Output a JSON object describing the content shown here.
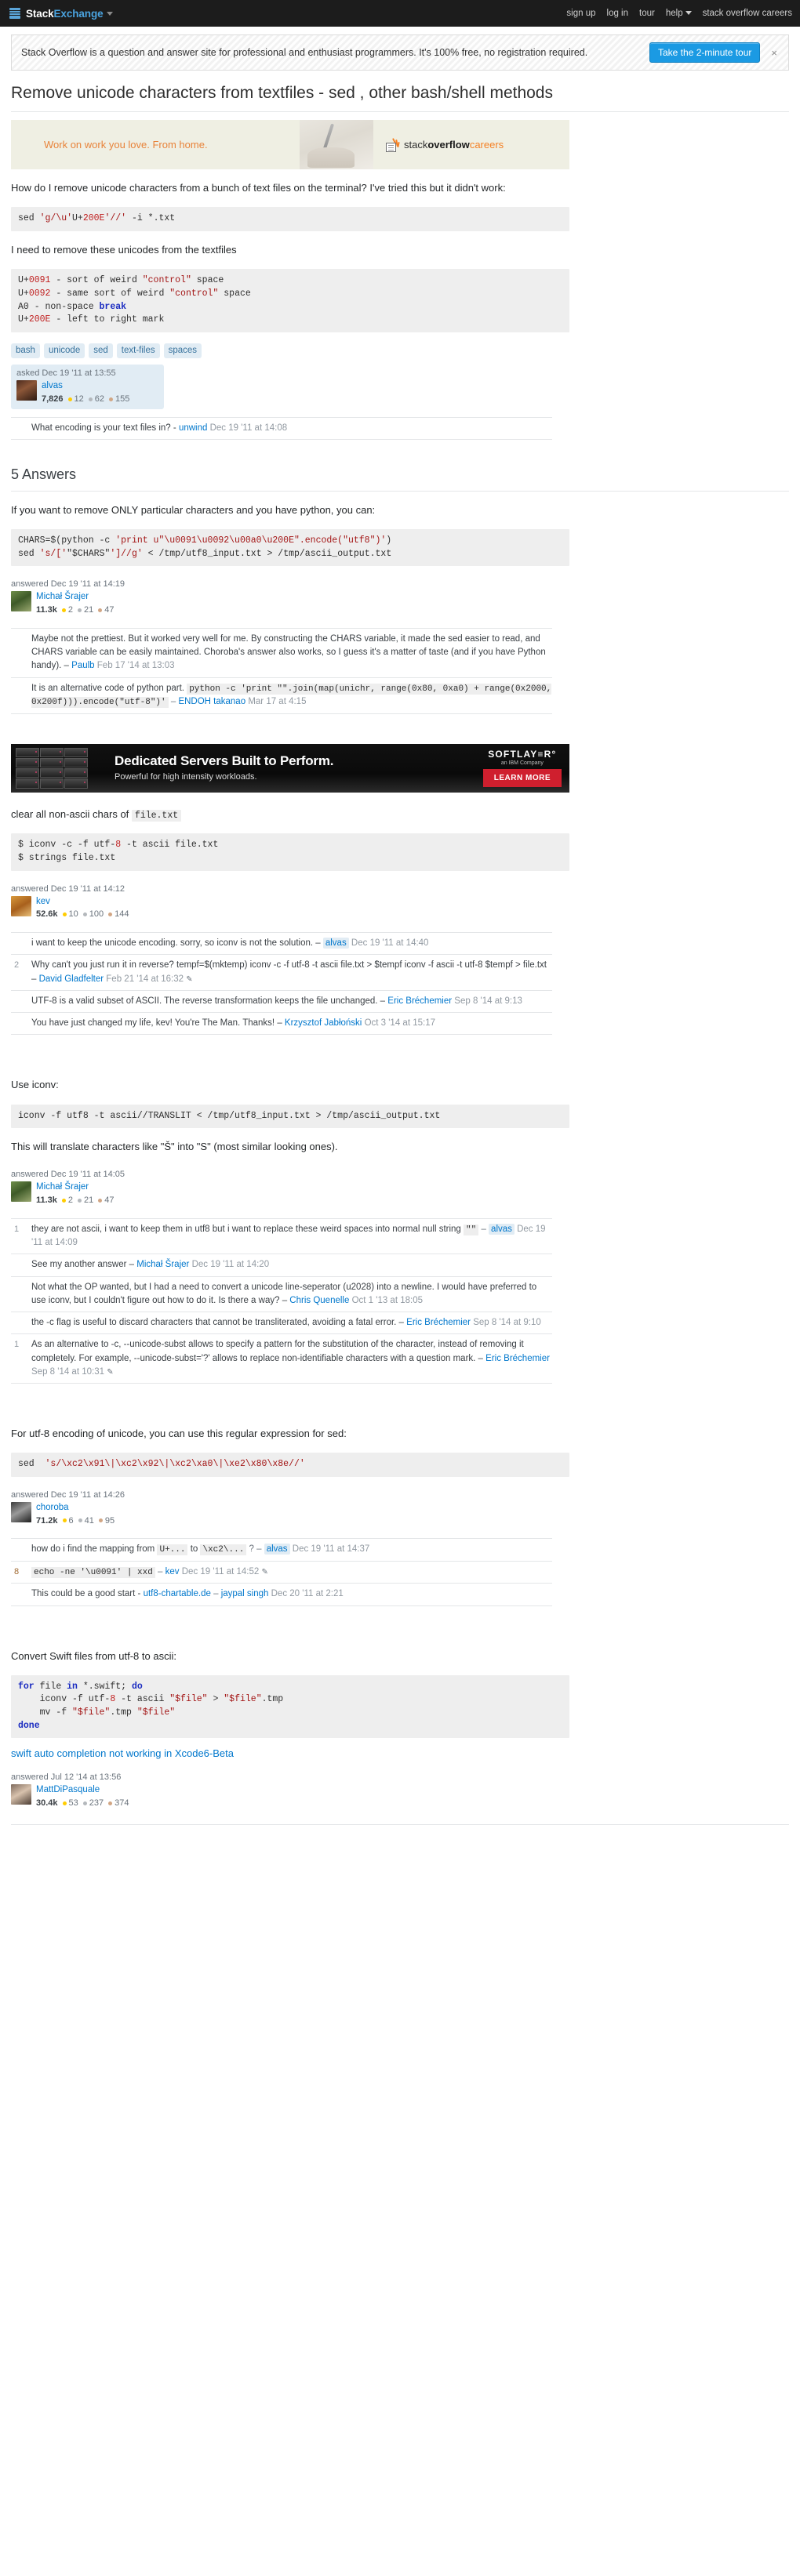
{
  "topbar": {
    "logo_icon": "stack-exchange-logo-icon",
    "brand_prefix": "Stack",
    "brand_suffix": "Exchange",
    "nav": [
      {
        "label": "sign up"
      },
      {
        "label": "log in"
      },
      {
        "label": "tour"
      },
      {
        "label": "help"
      },
      {
        "label": "stack overflow careers"
      }
    ]
  },
  "notice": {
    "text": "Stack Overflow is a question and answer site for professional and enthusiast programmers. It's 100% free, no registration required.",
    "tour_button": "Take the 2-minute tour",
    "close": "×"
  },
  "question": {
    "title": "Remove unicode characters from textfiles - sed , other bash/shell methods",
    "body_p1": "How do I remove unicode characters from a bunch of text files on the terminal? I've tried this but it didn't work:",
    "code1": "sed 'g/\\u'U+200E'//' -i *.txt",
    "body_p2": "I need to remove these unicodes from the textfiles",
    "code2_lines": [
      "U+0091 - sort of weird \"control\" space",
      "U+0092 - same sort of weird \"control\" space",
      "A0 - non-space break",
      "U+200E - left to right mark"
    ],
    "tags": [
      "bash",
      "unicode",
      "sed",
      "text-files",
      "spaces"
    ],
    "asked": "asked Dec 19 '11 at 13:55",
    "author": {
      "name": "alvas",
      "rep": "7,826",
      "gold": "12",
      "silver": "62",
      "bronze": "155",
      "avatar": "alvas"
    },
    "comments": [
      {
        "score": "",
        "text": "What encoding is your text files in? -",
        "user": "unwind",
        "owner": false,
        "date": "Dec 19 '11 at 14:08"
      }
    ]
  },
  "careers_ad": {
    "tagline": "Work on work you love. From home.",
    "logo_part1": "stack",
    "logo_part2": "overflow",
    "logo_part3": "careers"
  },
  "softlayer_ad": {
    "headline": "Dedicated Servers Built to Perform.",
    "subhead": "Powerful for high intensity workloads.",
    "logo": "SOFTLAY≡R°",
    "logo_sub": "an IBM Company",
    "cta": "LEARN MORE"
  },
  "answers_header": "5 Answers",
  "answers": [
    {
      "id": "answer-michal-python",
      "intro": "If you want to remove ONLY particular characters and you have python, you can:",
      "code_lines": [
        "CHARS=$(python -c 'print u\"\\u0091\\u0092\\u00a0\\u200E\".encode(\"utf8\")')",
        "sed 's/['\"$CHARS\"']//g' < /tmp/utf8_input.txt > /tmp/ascii_output.txt"
      ],
      "answered": "answered Dec 19 '11 at 14:19",
      "author": {
        "name": "Michał Šrajer",
        "rep": "11.3k",
        "gold": "2",
        "silver": "21",
        "bronze": "47",
        "avatar": "michal"
      },
      "comments": [
        {
          "score": "",
          "text": "Maybe not the prettiest. But it worked very well for me. By constructing the CHARS variable, it made the sed easier to read, and CHARS variable can be easily maintained. Choroba's answer also works, so I guess it's a matter of taste (and if you have Python handy). –",
          "user": "Paulb",
          "owner": false,
          "date": "Feb 17 '14 at 13:03"
        },
        {
          "score": "",
          "text_before": "It is an alternative code of python part.",
          "code": "python -c 'print \"\".join(map(unichr, range(0x80, 0xa0) + range(0x2000, 0x200f))).encode(\"utf-8\")'",
          "text_after": "–",
          "user": "ENDOH takanao",
          "owner": false,
          "date": "Mar 17 at 4:15"
        }
      ]
    },
    {
      "id": "answer-kev-iconv",
      "intro_before": "clear all non-ascii chars of",
      "intro_code": "file.txt",
      "code_lines": [
        "$ iconv -c -f utf-8 -t ascii file.txt",
        "$ strings file.txt"
      ],
      "answered": "answered Dec 19 '11 at 14:12",
      "author": {
        "name": "kev",
        "rep": "52.6k",
        "gold": "10",
        "silver": "100",
        "bronze": "144",
        "avatar": "kev"
      },
      "comments": [
        {
          "score": "",
          "text": "i want to keep the unicode encoding. sorry, so iconv is not the solution. –",
          "user": "alvas",
          "owner": true,
          "date": "Dec 19 '11 at 14:40"
        },
        {
          "score": "2",
          "text": "Why can't you just run it in reverse? tempf=$(mktemp) iconv -c -f utf-8 -t ascii file.txt > $tempf iconv -f ascii -t utf-8 $tempf > file.txt –",
          "user": "David Gladfelter",
          "owner": false,
          "date": "Feb 21 '14 at 16:32",
          "edited": true
        },
        {
          "score": "",
          "text": "UTF-8 is a valid subset of ASCII. The reverse transformation keeps the file unchanged. –",
          "user": "Eric Bréchemier",
          "owner": false,
          "date": "Sep 8 '14 at 9:13"
        },
        {
          "score": "",
          "text": "You have just changed my life, kev! You're The Man. Thanks! –",
          "user": "Krzysztof Jabłoński",
          "owner": false,
          "date": "Oct 3 '14 at 15:17"
        }
      ]
    },
    {
      "id": "answer-michal-translit",
      "intro": "Use iconv:",
      "code_lines": [
        "iconv -f utf8 -t ascii//TRANSLIT < /tmp/utf8_input.txt > /tmp/ascii_output.txt"
      ],
      "outro": "This will translate characters like \"Š\" into \"S\" (most similar looking ones).",
      "answered": "answered Dec 19 '11 at 14:05",
      "author": {
        "name": "Michał Šrajer",
        "rep": "11.3k",
        "gold": "2",
        "silver": "21",
        "bronze": "47",
        "avatar": "michal"
      },
      "comments": [
        {
          "score": "1",
          "text_before": "they are not ascii, i want to keep them in utf8 but i want to replace these weird spaces into normal null string",
          "code": "\"\"",
          "text_after": "–",
          "user": "alvas",
          "owner": true,
          "date": "Dec 19 '11 at 14:09"
        },
        {
          "score": "",
          "text": "See my another answer –",
          "user": "Michał Šrajer",
          "owner": false,
          "date": "Dec 19 '11 at 14:20"
        },
        {
          "score": "",
          "text": "Not what the OP wanted, but I had a need to convert a unicode line-seperator (u2028) into a newline. I would have preferred to use iconv, but I couldn't figure out how to do it. Is there a way? –",
          "user": "Chris Quenelle",
          "owner": false,
          "date": "Oct 1 '13 at 18:05"
        },
        {
          "score": "",
          "text": "the -c flag is useful to discard characters that cannot be transliterated, avoiding a fatal error. –",
          "user": "Eric Bréchemier",
          "owner": false,
          "date": "Sep 8 '14 at 9:10"
        },
        {
          "score": "1",
          "text": "As an alternative to -c, --unicode-subst allows to specify a pattern for the substitution of the character, instead of removing it completely. For example, --unicode-subst='?' allows to replace non-identifiable characters with a question mark. –",
          "user": "Eric Bréchemier",
          "owner": false,
          "date": "Sep 8 '14 at 10:31",
          "edited": true
        }
      ]
    },
    {
      "id": "answer-choroba-regex",
      "intro": "For utf-8 encoding of unicode, you can use this regular expression for sed:",
      "code_lines": [
        "sed 's/\\xc2\\x91\\|\\xc2\\x92\\|\\xc2\\xa0\\|\\xe2\\x80\\x8e//'"
      ],
      "answered": "answered Dec 19 '11 at 14:26",
      "author": {
        "name": "choroba",
        "rep": "71.2k",
        "gold": "6",
        "silver": "41",
        "bronze": "95",
        "avatar": "choroba"
      },
      "comments": [
        {
          "score": "",
          "text_before": "how do i find the mapping from",
          "code": "U+...",
          "text_mid": "to",
          "code2": "\\xc2\\...",
          "text_after": "? –",
          "user": "alvas",
          "owner": true,
          "date": "Dec 19 '11 at 14:37"
        },
        {
          "score": "8",
          "code_only": "echo -ne '\\u0091' | xxd",
          "text_after": "–",
          "user": "kev",
          "owner": false,
          "date": "Dec 19 '11 at 14:52",
          "edited": true
        },
        {
          "score": "",
          "text_before": "This could be a good start -",
          "link": "utf8-chartable.de",
          "text_after": "–",
          "user": "jaypal singh",
          "owner": false,
          "date": "Dec 20 '11 at 2:21"
        }
      ]
    },
    {
      "id": "answer-matt-swift",
      "intro": "Convert Swift files from utf-8 to ascii:",
      "code_lines": [
        "for file in *.swift; do",
        "    iconv -f utf-8 -t ascii \"$file\" > \"$file\".tmp",
        "    mv -f \"$file\".tmp \"$file\"",
        "done"
      ],
      "link_text": "swift auto completion not working in Xcode6-Beta",
      "answered": "answered Jul 12 '14 at 13:56",
      "author": {
        "name": "MattDiPasquale",
        "rep": "30.4k",
        "gold": "53",
        "silver": "237",
        "bronze": "374",
        "avatar": "matt"
      },
      "comments": []
    }
  ]
}
